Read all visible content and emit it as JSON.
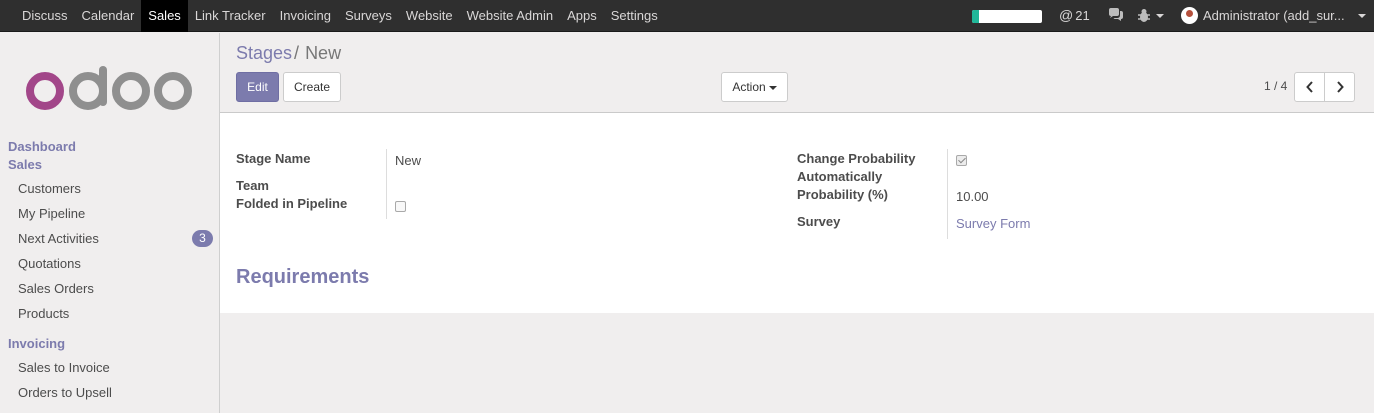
{
  "topbar": {
    "menu": [
      "Discuss",
      "Calendar",
      "Sales",
      "Link Tracker",
      "Invoicing",
      "Surveys",
      "Website",
      "Website Admin",
      "Apps",
      "Settings"
    ],
    "active": "Sales",
    "progress_fraction": 0.1,
    "progress_color": "#21b799",
    "mention_count": "21",
    "user_label": "Administrator (add_sur..."
  },
  "sidebar": {
    "logo_icon": "odoo-logo-icon",
    "sections": [
      {
        "title": "Dashboard"
      },
      {
        "title": "Sales",
        "items": [
          {
            "label": "Customers"
          },
          {
            "label": "My Pipeline"
          },
          {
            "label": "Next Activities",
            "badge": "3"
          },
          {
            "label": "Quotations"
          },
          {
            "label": "Sales Orders"
          },
          {
            "label": "Products"
          }
        ]
      },
      {
        "title": "Invoicing",
        "items": [
          {
            "label": "Sales to Invoice"
          },
          {
            "label": "Orders to Upsell"
          }
        ]
      }
    ]
  },
  "control_panel": {
    "breadcrumb_parent": "Stages",
    "breadcrumb_sep": "/",
    "breadcrumb_current": "New",
    "edit_label": "Edit",
    "create_label": "Create",
    "action_label": "Action",
    "pager_value": "1 / 4"
  },
  "form": {
    "stage_name_label": "Stage Name",
    "stage_name_value": "New",
    "team_label": "Team",
    "team_value": "",
    "folded_label": "Folded in Pipeline",
    "folded_checked": false,
    "change_prob_label_line1": "Change Probability",
    "change_prob_label_line2": "Automatically",
    "change_prob_checked": true,
    "probability_label": "Probability (%)",
    "probability_value": "10.00",
    "survey_label": "Survey",
    "survey_value": "Survey Form",
    "requirements_title": "Requirements"
  },
  "colors": {
    "brand": "#7c7bad",
    "topbar": "#2f2f2f",
    "badge": "#7c7bad"
  }
}
